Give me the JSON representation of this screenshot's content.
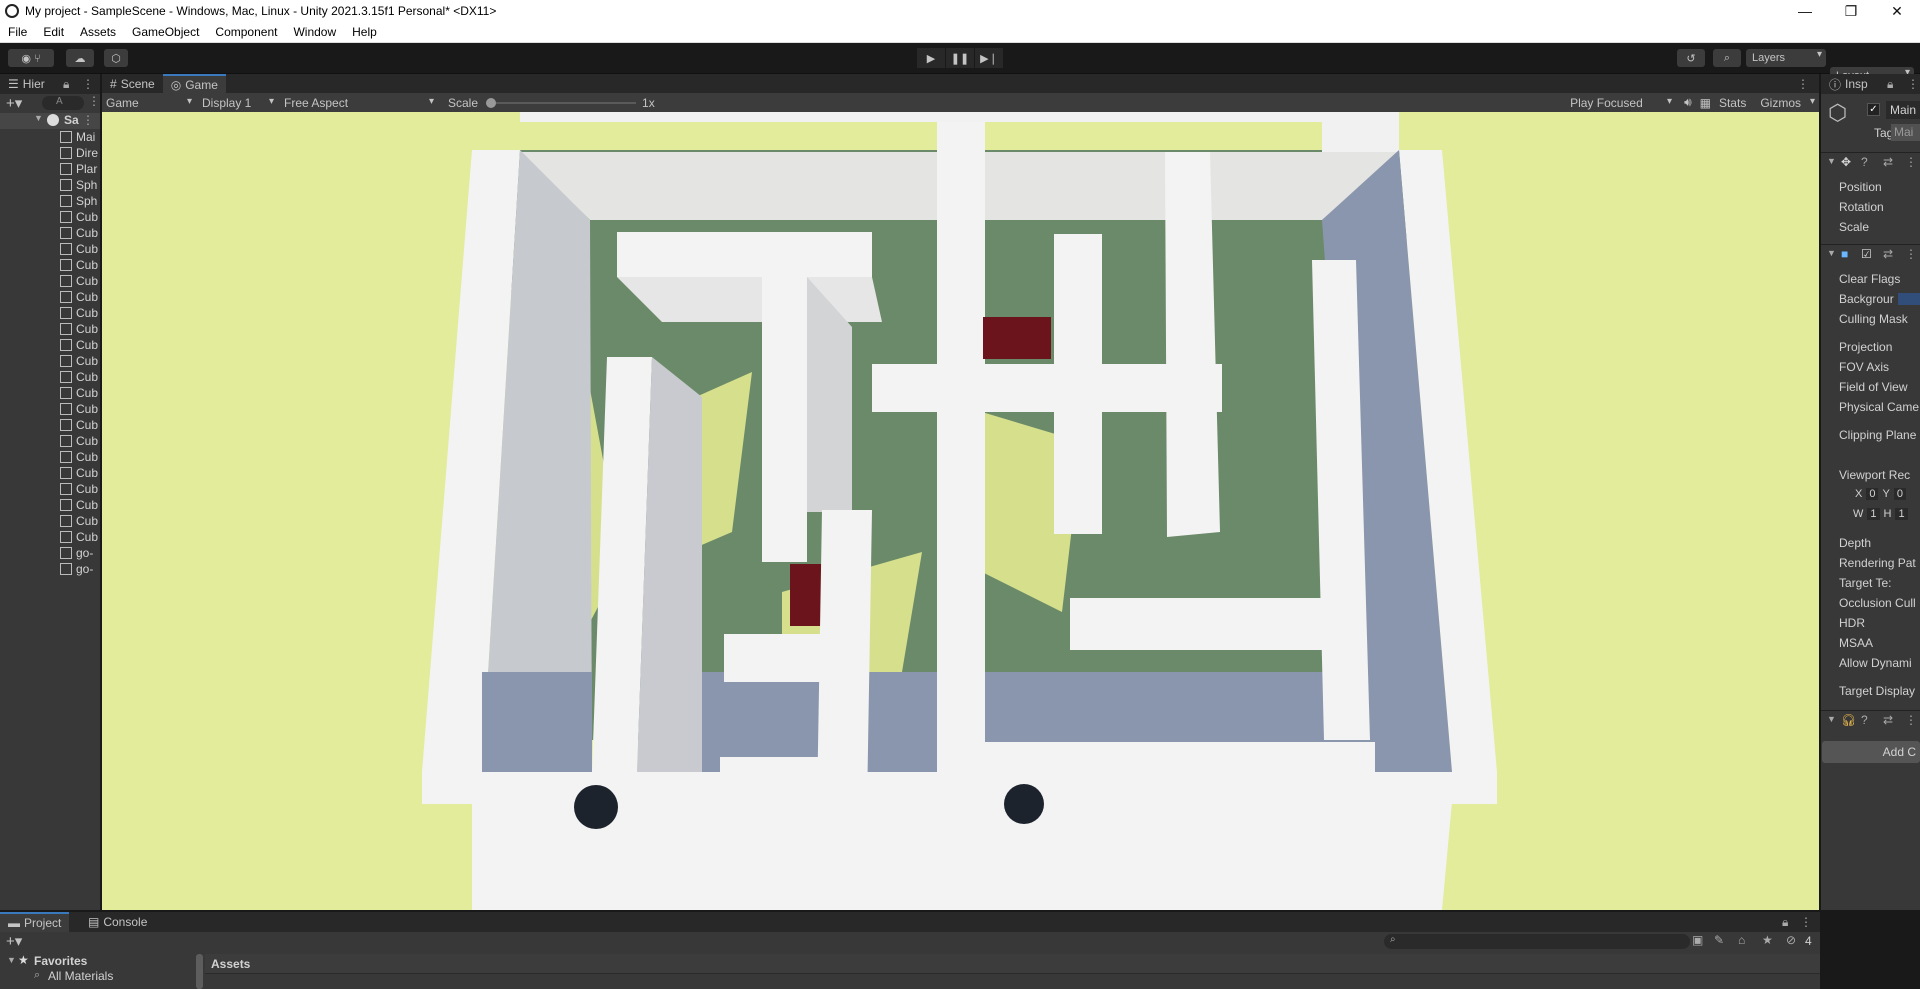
{
  "window": {
    "title": "My project - SampleScene - Windows, Mac, Linux - Unity 2021.3.15f1 Personal* <DX11>",
    "minimize": "—",
    "maximize": "❐",
    "close": "✕"
  },
  "menu": [
    "File",
    "Edit",
    "Assets",
    "GameObject",
    "Component",
    "Window",
    "Help"
  ],
  "toolbar": {
    "layers": "Layers",
    "layout": "Layout"
  },
  "hierarchy": {
    "tab": "Hier",
    "search_placeholder": "A",
    "scene": "Sa",
    "items": [
      "Mai",
      "Dire",
      "Plar",
      "Sph",
      "Sph",
      "Cub",
      "Cub",
      "Cub",
      "Cub",
      "Cub",
      "Cub",
      "Cub",
      "Cub",
      "Cub",
      "Cub",
      "Cub",
      "Cub",
      "Cub",
      "Cub",
      "Cub",
      "Cub",
      "Cub",
      "Cub",
      "Cub",
      "Cub",
      "Cub",
      "go-",
      "go-"
    ]
  },
  "center_tabs": {
    "scene": "Scene",
    "game": "Game"
  },
  "game_toolbar": {
    "mode": "Game",
    "display": "Display 1",
    "aspect": "Free Aspect",
    "scale_label": "Scale",
    "scale_value": "1x",
    "play_focused": "Play Focused",
    "stats": "Stats",
    "gizmos": "Gizmos"
  },
  "inspector": {
    "tab": "Insp",
    "object_name": "Main",
    "tag_label": "Tag",
    "tag_value": "Mai",
    "transform": [
      "Position",
      "Rotation",
      "Scale"
    ],
    "camera": [
      "Clear Flags",
      "Backgrour",
      "Culling Mask",
      "Projection",
      "FOV Axis",
      "Field of View",
      "Physical Came",
      "Clipping Plane",
      "Viewport Rec",
      "Depth",
      "Rendering Pat",
      "Target Te:",
      "Occlusion Cull",
      "HDR",
      "MSAA",
      "Allow Dynami",
      "Target Display"
    ],
    "viewport": {
      "x_label": "X",
      "x": "0",
      "y_label": "Y",
      "y": "0",
      "w_label": "W",
      "w": "1",
      "h_label": "H",
      "h": "1"
    },
    "add_component": "Add C",
    "background_color": "#314d79"
  },
  "bottom": {
    "project_tab": "Project",
    "console_tab": "Console",
    "favorites": "Favorites",
    "all_materials": "All Materials",
    "assets": "Assets",
    "hidden_count": "4"
  }
}
